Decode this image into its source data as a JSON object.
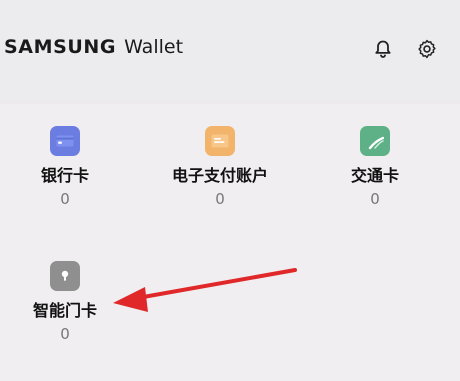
{
  "header": {
    "brand": "SAMSUNG",
    "product": "Wallet",
    "bell_icon": "bell-icon",
    "settings_icon": "gear-icon"
  },
  "cards": [
    {
      "label": "银行卡",
      "count": "0",
      "icon": "bank-card-icon",
      "color": "#6b7de0"
    },
    {
      "label": "电子支付账户",
      "count": "0",
      "icon": "payment-account-icon",
      "color": "#f2b36a"
    },
    {
      "label": "交通卡",
      "count": "0",
      "icon": "transit-card-icon",
      "color": "#5eb086"
    },
    {
      "label": "智能门卡",
      "count": "0",
      "icon": "door-card-icon",
      "color": "#8f8f8f"
    }
  ],
  "annotation": {
    "arrow_color": "#e0282a"
  }
}
